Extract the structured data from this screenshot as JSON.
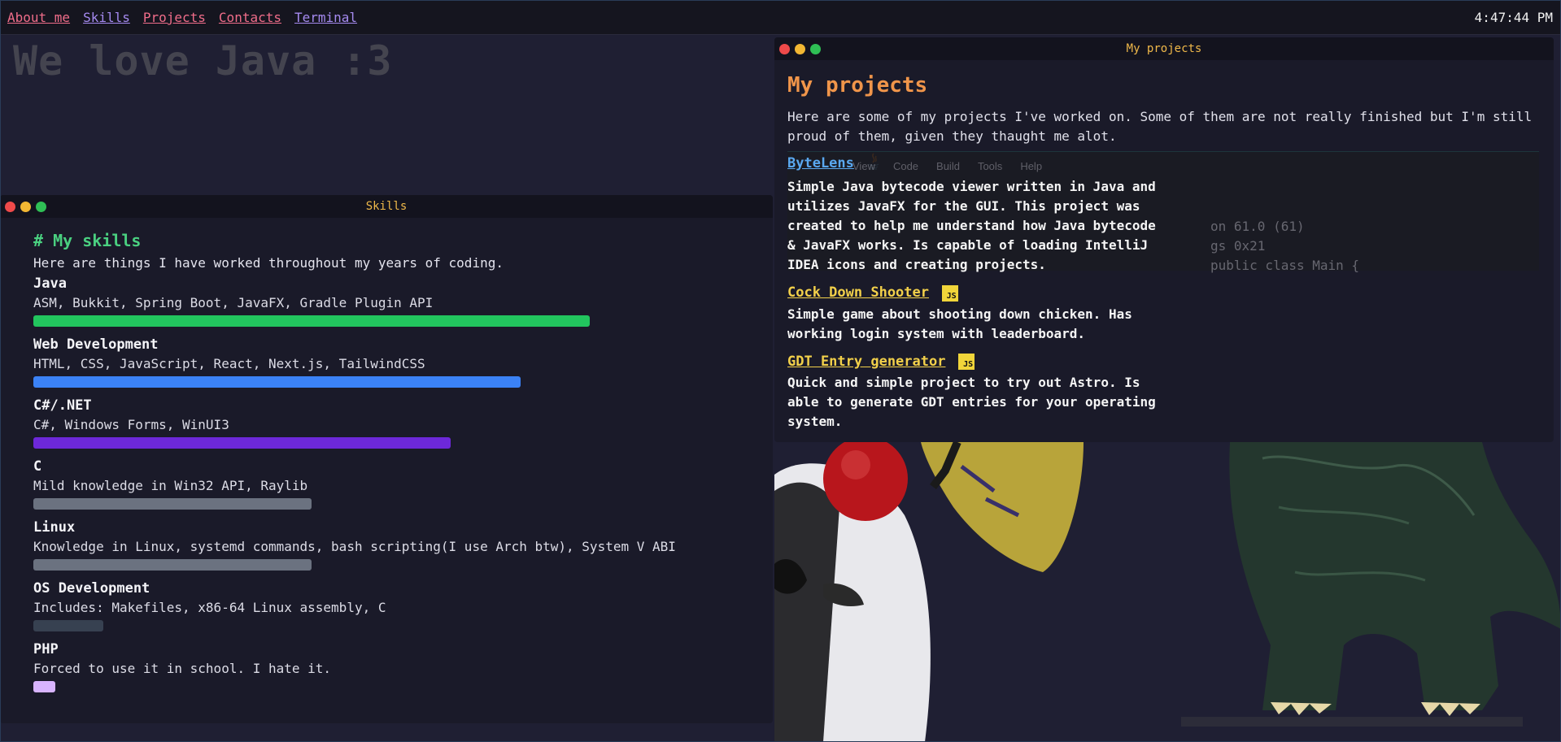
{
  "nav": {
    "items": [
      {
        "label": "About me",
        "color": "#f06d8a"
      },
      {
        "label": "Skills",
        "color": "#a58af0"
      },
      {
        "label": "Projects",
        "color": "#f06d8a"
      },
      {
        "label": "Contacts",
        "color": "#f06d8a"
      },
      {
        "label": "Terminal",
        "color": "#a58af0"
      }
    ],
    "clock": "4:47:44 PM"
  },
  "hero": {
    "text": "We love Java :3"
  },
  "skills_window": {
    "title": "Skills",
    "heading": "# My skills",
    "intro": "Here are things I have worked throughout my years of coding.",
    "items": [
      {
        "name": "Java",
        "desc": "ASM, Bukkit, Spring Boot, JavaFX, Gradle Plugin API",
        "level": 0.76,
        "color": "#22c55e"
      },
      {
        "name": "Web Development",
        "desc": "HTML, CSS, JavaScript, React, Next.js, TailwindCSS",
        "level": 0.665,
        "color": "#3b82f6"
      },
      {
        "name": "C#/.NET",
        "desc": "C#, Windows Forms, WinUI3",
        "level": 0.57,
        "color": "#6d28d9"
      },
      {
        "name": "C",
        "desc": "Mild knowledge in Win32 API, Raylib",
        "level": 0.38,
        "color": "#6b7280"
      },
      {
        "name": "Linux",
        "desc": "Knowledge in Linux, systemd commands, bash scripting(I use Arch btw), System V ABI",
        "level": 0.38,
        "color": "#6b7280"
      },
      {
        "name": "OS Development",
        "desc": "Includes: Makefiles, x86-64 Linux assembly, C",
        "level": 0.095,
        "color": "#374151"
      },
      {
        "name": "PHP",
        "desc": "Forced to use it in school. I hate it.",
        "level": 0.03,
        "color": "#d8b4fe"
      }
    ]
  },
  "projects_window": {
    "title": "My projects",
    "heading": "My projects",
    "intro": "Here are some of my projects I've worked on. Some of them are not really finished but I'm still proud of them, given they thaught me alot.",
    "items": [
      {
        "title": "ByteLens",
        "lang_icon": "java-icon",
        "desc": "Simple Java bytecode viewer written in Java and utilizes JavaFX for the GUI. This project was created to help me understand how Java bytecode & JavaFX works. Is capable of loading IntelliJ IDEA icons and creating projects."
      },
      {
        "title": "Cock Down Shooter",
        "lang_icon": "js-icon",
        "desc": "Simple game about shooting down chicken. Has working login system with leaderboard."
      },
      {
        "title": "GDT Entry generator",
        "lang_icon": "js-icon",
        "desc": "Quick and simple project to try out Astro. Is able to generate GDT entries for your operating system."
      }
    ],
    "js_badge_text": "JS",
    "ide_preview": {
      "menu": [
        "View",
        "Code",
        "Build",
        "Tools",
        "Help"
      ],
      "code_lines": [
        "on 61.0 (61)",
        "gs 0x21",
        "public class Main {"
      ]
    }
  }
}
